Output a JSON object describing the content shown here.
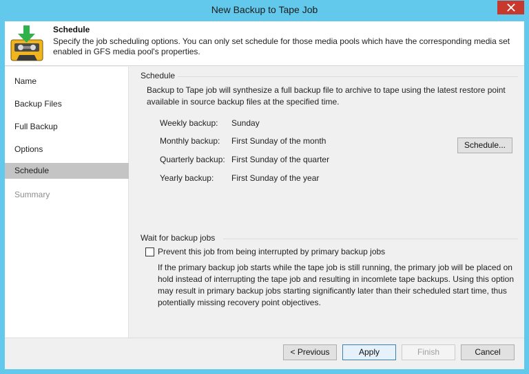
{
  "window": {
    "title": "New Backup to Tape Job"
  },
  "header": {
    "title": "Schedule",
    "description": "Specify the job scheduling options. You can only set schedule for those media pools which have the corresponding media set enabled in GFS media pool's properties.",
    "icon": "tape-download-icon"
  },
  "sidebar": {
    "items": [
      {
        "label": "Name"
      },
      {
        "label": "Backup Files"
      },
      {
        "label": "Full Backup"
      },
      {
        "label": "Options"
      },
      {
        "label": "Schedule"
      },
      {
        "label": "Summary"
      }
    ],
    "active_item": "Schedule"
  },
  "schedule": {
    "group_label": "Schedule",
    "description": "Backup to Tape job will synthesize a full backup file to archive to tape using the latest restore point available in source backup files at the specified time.",
    "rows": [
      {
        "label": "Weekly backup:",
        "value": "Sunday"
      },
      {
        "label": "Monthly backup:",
        "value": "First Sunday of the month"
      },
      {
        "label": "Quarterly backup:",
        "value": "First Sunday of the quarter"
      },
      {
        "label": "Yearly backup:",
        "value": "First Sunday of the year"
      }
    ],
    "schedule_button": "Schedule..."
  },
  "wait": {
    "group_label": "Wait for backup jobs",
    "checkbox_label": "Prevent this job from being interrupted by primary backup jobs",
    "checked": false,
    "description": "If the primary backup job starts while the tape job is still running, the primary job will be placed on hold instead of interrupting the tape job and resulting in incomlete tape backups. Using this option may result in primary backup jobs starting significantly later than their scheduled start time, thus potentially missing recovery point objectives."
  },
  "footer": {
    "previous": "< Previous",
    "apply": "Apply",
    "finish": "Finish",
    "cancel": "Cancel"
  },
  "colors": {
    "titlebar": "#63c9ec",
    "close": "#c7382d",
    "active_item": "#c4c4c4",
    "icon_green": "#2fb24a",
    "icon_yellow": "#f0b51c"
  }
}
